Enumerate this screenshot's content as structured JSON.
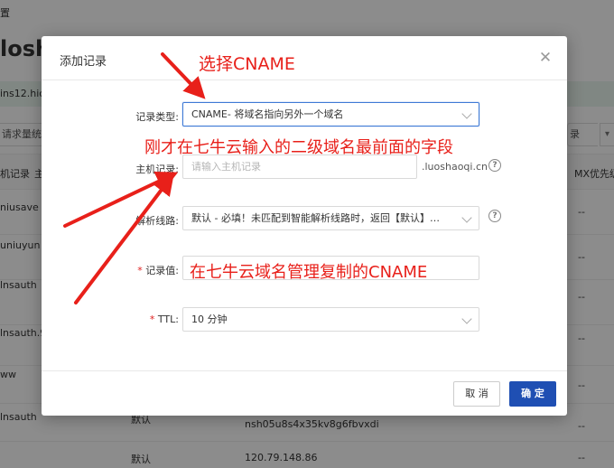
{
  "background": {
    "breadcrumb": "置",
    "brand": "losh",
    "dns_server": "ins12.hic",
    "request_button": "请求量统",
    "record_button": "录",
    "table": {
      "headers": [
        "机记录",
        "主",
        "MX优先级"
      ],
      "rows": [
        {
          "host": "niusave",
          "mx": "--"
        },
        {
          "host": "uniuyun",
          "mx": "--"
        },
        {
          "host": "lnsauth",
          "mx": "--"
        },
        {
          "host": "lnsauth.9",
          "mx": "--"
        },
        {
          "host": "ww",
          "mx": "--"
        },
        {
          "host": "lnsauth",
          "line": "默认",
          "value": "nsh05u8s4x35kv8g6fbvxdi",
          "mx": "--"
        },
        {
          "host": "",
          "line": "默认",
          "value": "120.79.148.86",
          "mx": "--"
        }
      ]
    }
  },
  "dialog": {
    "title": "添加记录",
    "record_type": {
      "label": "记录类型:",
      "value": "CNAME- 将域名指向另外一个域名"
    },
    "host_record": {
      "label": "主机记录:",
      "placeholder": "请输入主机记录",
      "suffix": ".luoshaoqi.cn"
    },
    "line": {
      "label": "解析线路:",
      "value": "默认 - 必填！未匹配到智能解析线路时，返回【默认】线路..."
    },
    "record_value": {
      "label": "记录值:",
      "required_mark": "*"
    },
    "ttl": {
      "label": "TTL:",
      "required_mark": "*",
      "value": "10 分钟"
    },
    "cancel_label": "取 消",
    "ok_label": "确 定",
    "help_glyph": "?"
  },
  "annotations": {
    "select_cname": "选择CNAME",
    "host_hint": "刚才在七牛云输入的二级域名最前面的字段",
    "value_hint": "在七牛云域名管理复制的CNAME",
    "color": "#e8201a"
  },
  "theme": {
    "primary": "#1f4fb3",
    "focus_border": "#3f7ad6",
    "required": "#e02020"
  }
}
